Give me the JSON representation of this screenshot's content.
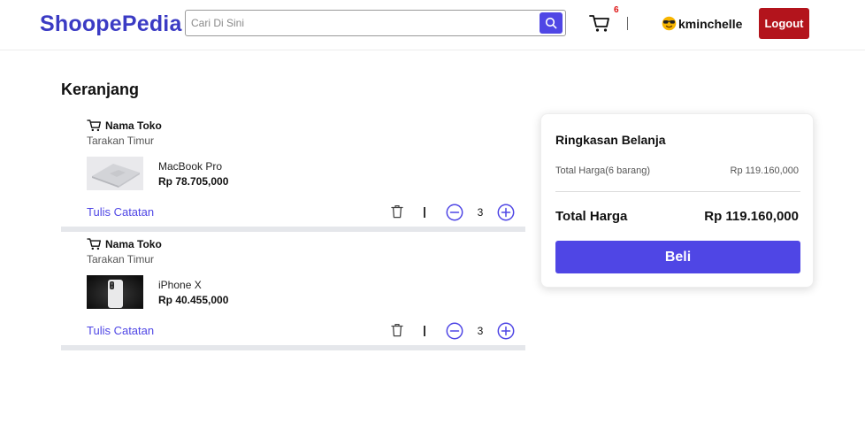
{
  "header": {
    "brand": "ShoopePedia",
    "search_placeholder": "Cari Di Sini",
    "search_value": "",
    "cart_count": "6",
    "username": "kminchelle",
    "logout_label": "Logout"
  },
  "page_title": "Keranjang",
  "cart_items": [
    {
      "store_name": "Nama Toko",
      "store_city": "Tarakan Timur",
      "product_name": "MacBook Pro",
      "price": "Rp 78.705,000",
      "note_label": "Tulis Catatan",
      "quantity": "3"
    },
    {
      "store_name": "Nama Toko",
      "store_city": "Tarakan Timur",
      "product_name": "iPhone X",
      "price": "Rp 40.455,000",
      "note_label": "Tulis Catatan",
      "quantity": "3"
    }
  ],
  "summary": {
    "title": "Ringkasan Belanja",
    "subtotal_label": "Total Harga(6 barang)",
    "subtotal_value": "Rp 119.160,000",
    "total_label": "Total Harga",
    "total_value": "Rp 119.160,000",
    "buy_label": "Beli"
  },
  "icons": {
    "search": "search-icon",
    "cart": "cart-icon",
    "avatar": "sunglasses-emoji-icon",
    "trash": "trash-icon",
    "minus": "minus-circle-icon",
    "plus": "plus-circle-icon"
  },
  "colors": {
    "brand": "#3b3bc4",
    "accent": "#4f46e5",
    "logout": "#b3141c",
    "badge": "#dd1111"
  }
}
